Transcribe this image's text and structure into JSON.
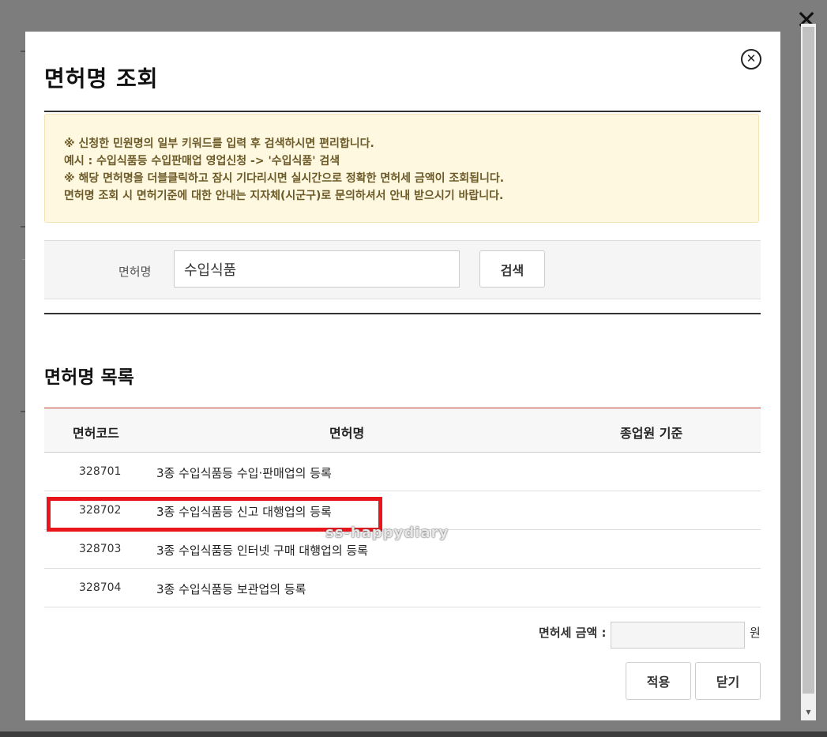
{
  "modal": {
    "title": "면허명 조회",
    "close_icon": "⊗"
  },
  "notice": {
    "lines": [
      "※ 신청한 민원명의 일부 키워드를 입력 후 검색하시면 편리합니다.",
      "예시 : 수입식품등 수입판매업 영업신청 -> '수입식품' 검색",
      "※ 해당 면허명을 더블클릭하고 잠시 기다리시면 실시간으로 정확한 면허세 금액이 조회됩니다.",
      "면허명 조회 시 면허기준에 대한 안내는 지자체(시군구)로 문의하셔서 안내 받으시기 바랍니다."
    ]
  },
  "search": {
    "label": "면허명",
    "value": "수입식품",
    "button": "검색"
  },
  "list": {
    "title": "면허명 목록",
    "columns": [
      "면허코드",
      "면허명",
      "종업원 기준"
    ],
    "rows": [
      {
        "code": "328701",
        "name": "3종 수입식품등 수입·판매업의 등록",
        "criteria": ""
      },
      {
        "code": "328702",
        "name": "3종 수입식품등 신고 대행업의 등록",
        "criteria": ""
      },
      {
        "code": "328703",
        "name": "3종 수입식품등 인터넷 구매 대행업의 등록",
        "criteria": ""
      },
      {
        "code": "328704",
        "name": "3종 수입식품등 보관업의 등록",
        "criteria": ""
      }
    ]
  },
  "fee": {
    "label": "면허세 금액 :",
    "value": "",
    "unit": "원"
  },
  "buttons": {
    "apply": "적용",
    "close": "닫기"
  },
  "watermark": "ss-happydiary",
  "window_close_icon": "✕",
  "colors": {
    "highlight": "#e8151b",
    "notice_bg": "#fff8e1",
    "table_top_border": "#c0392b"
  }
}
